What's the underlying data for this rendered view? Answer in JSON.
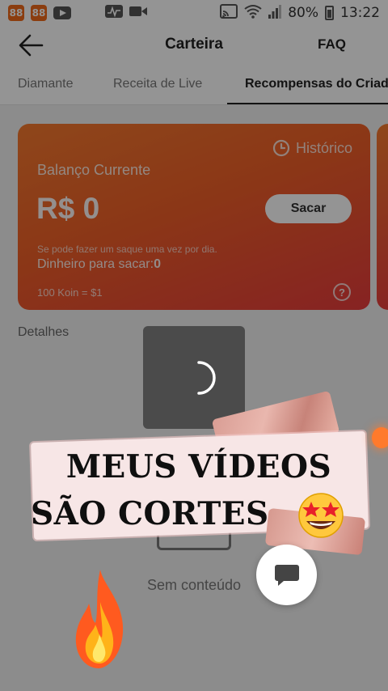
{
  "status_bar": {
    "app_icons": [
      "app-icon-orange",
      "app-icon-orange",
      "youtube-icon"
    ],
    "notification_icons": [
      "activity-icon",
      "video-camera-icon"
    ],
    "right_icons": [
      "cast-icon",
      "wifi-icon",
      "signal-icon"
    ],
    "battery_percent": "80%",
    "time": "13:22"
  },
  "header": {
    "title": "Carteira",
    "faq_label": "FAQ",
    "back_icon": "arrow-left-icon"
  },
  "tabs": [
    {
      "label": "Diamante",
      "active": false
    },
    {
      "label": "Receita de Live",
      "active": false
    },
    {
      "label": "Recompensas do Criador",
      "active": true
    }
  ],
  "card": {
    "history_label": "Histórico",
    "history_icon": "clock-icon",
    "balance_label": "Balanço Currente",
    "balance_value": "R$ 0",
    "withdraw_button": "Sacar",
    "note": "Se pode fazer um saque uma vez por dia.",
    "withdrawable_label": "Dinheiro para sacar:",
    "withdrawable_value": "0",
    "rate": "100 Koin = $1",
    "help_icon": "question-circle-icon",
    "gradient_from": "#f57a2e",
    "gradient_to": "#e83c3c"
  },
  "details": {
    "heading": "Detalhes",
    "empty_text": "Sem conteúdo"
  },
  "loading": {
    "spinner_icon": "spinner-icon"
  },
  "caption": {
    "line1": "MEUS VÍDEOS",
    "line2": "SÃO CORTES",
    "emoji": "star-struck-emoji",
    "flame": "fire-emoji"
  },
  "chat_button_icon": "chat-bubble-icon",
  "colors": {
    "accent": "#f05f28",
    "overlay": "rgba(0,0,0,0.42)"
  }
}
